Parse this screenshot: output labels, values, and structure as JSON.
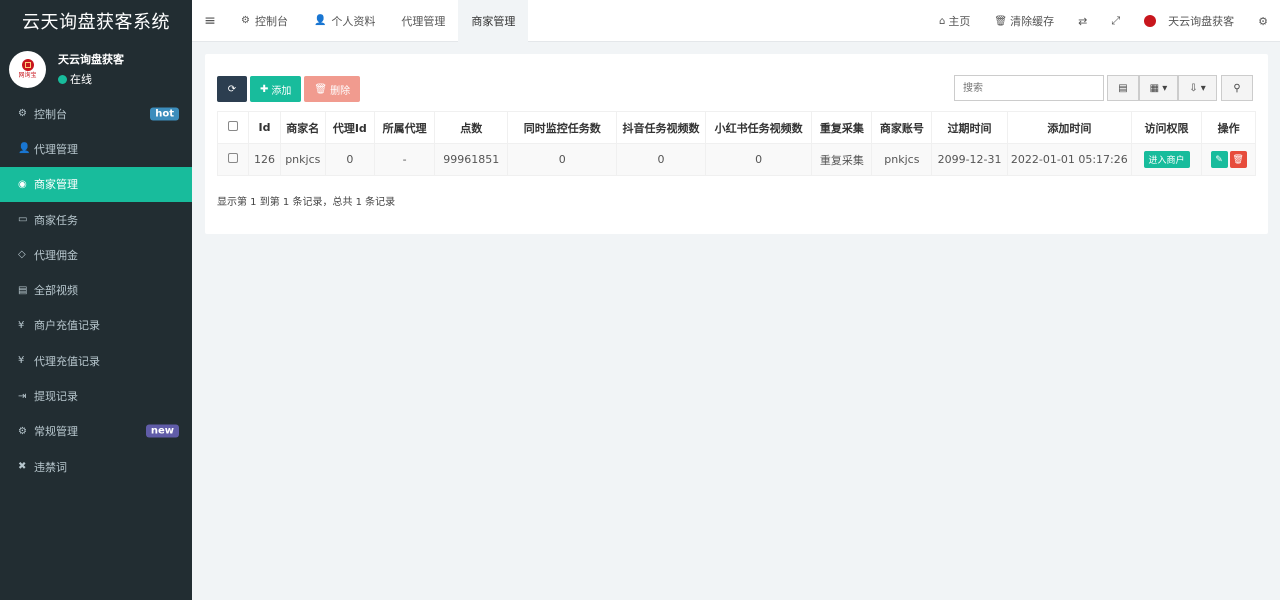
{
  "app": {
    "title": "云天询盘获客系统"
  },
  "user": {
    "name": "天云询盘获客",
    "status": "在线",
    "logo_text": "网询宝"
  },
  "sidebar": {
    "items": [
      {
        "label": "控制台",
        "icon": "dashboard-icon",
        "glyph": "⚙",
        "badge": "hot",
        "badge_color": "#3c8dbc"
      },
      {
        "label": "代理管理",
        "icon": "user-plus-icon",
        "glyph": "👤"
      },
      {
        "label": "商家管理",
        "icon": "eye-icon",
        "glyph": "◉",
        "active": true
      },
      {
        "label": "商家任务",
        "icon": "keyboard-icon",
        "glyph": "▭"
      },
      {
        "label": "代理佣金",
        "icon": "diamond-icon",
        "glyph": "◇"
      },
      {
        "label": "全部视频",
        "icon": "file-video-icon",
        "glyph": "▤"
      },
      {
        "label": "商户充值记录",
        "icon": "yen-icon",
        "glyph": "¥"
      },
      {
        "label": "代理充值记录",
        "icon": "yen-icon",
        "glyph": "¥"
      },
      {
        "label": "提现记录",
        "icon": "sign-in-icon",
        "glyph": "⇥"
      },
      {
        "label": "常规管理",
        "icon": "cogs-icon",
        "glyph": "⚙",
        "badge": "new",
        "badge_color": "#605ca8"
      },
      {
        "label": "违禁词",
        "icon": "times-icon",
        "glyph": "✖"
      }
    ]
  },
  "topbar": {
    "tabs": [
      {
        "label": "控制台",
        "glyph": "⚙"
      },
      {
        "label": "个人资料",
        "glyph": "👤"
      },
      {
        "label": "代理管理",
        "glyph": ""
      },
      {
        "label": "商家管理",
        "glyph": "",
        "active": true
      }
    ],
    "home": "主页",
    "clear_cache": "清除缓存",
    "account": "天云询盘获客"
  },
  "toolbar": {
    "add": "添加",
    "delete": "删除",
    "search_placeholder": "搜索"
  },
  "table": {
    "headers": [
      "Id",
      "商家名",
      "代理Id",
      "所属代理",
      "点数",
      "同时监控任务数",
      "抖音任务视频数",
      "小红书任务视频数",
      "重复采集",
      "商家账号",
      "过期时间",
      "添加时间",
      "访问权限",
      "操作"
    ],
    "rows": [
      [
        "126",
        "pnkjcs",
        "0",
        "-",
        "99961851",
        "0",
        "0",
        "0",
        "重复采集",
        "pnkjcs",
        "2099-12-31",
        "2022-01-01 05:17:26",
        "进入商户",
        ""
      ]
    ],
    "summary": "显示第 1 到第 1 条记录，总共 1 条记录"
  },
  "colors": {
    "accent": "#18bc9c",
    "sidebar": "#222d32",
    "danger": "#e74c3c",
    "dark": "#2c3e50"
  }
}
